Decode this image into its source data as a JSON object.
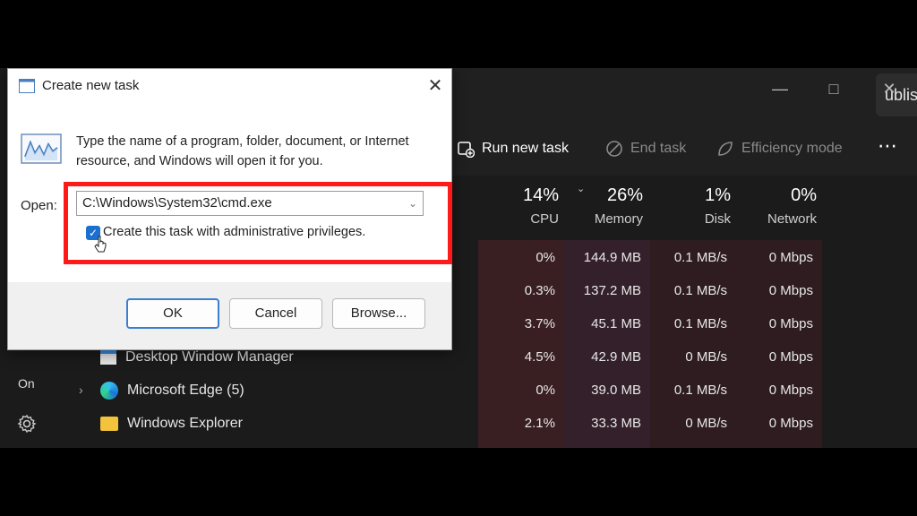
{
  "dialog": {
    "title": "Create new task",
    "description": "Type the name of a program, folder, document, or Internet resource, and Windows will open it for you.",
    "open_label": "Open:",
    "open_value": "C:\\Windows\\System32\\cmd.exe",
    "admin_checkbox_label": "Create this task with administrative privileges.",
    "admin_checked": true,
    "ok_label": "OK",
    "cancel_label": "Cancel",
    "browse_label": "Browse..."
  },
  "task_manager": {
    "search_text": "ublisher, or PID to se...",
    "toolbar": {
      "run_new_task": "Run new task",
      "end_task": "End task",
      "efficiency_mode": "Efficiency mode"
    },
    "columns": [
      {
        "pct": "14%",
        "label": "CPU"
      },
      {
        "pct": "26%",
        "label": "Memory"
      },
      {
        "pct": "1%",
        "label": "Disk"
      },
      {
        "pct": "0%",
        "label": "Network"
      }
    ],
    "rows": [
      {
        "name": "",
        "cpu": "0%",
        "memory": "144.9 MB",
        "disk": "0.1 MB/s",
        "network": "0 Mbps"
      },
      {
        "name": "",
        "cpu": "0.3%",
        "memory": "137.2 MB",
        "disk": "0.1 MB/s",
        "network": "0 Mbps"
      },
      {
        "name": "",
        "cpu": "3.7%",
        "memory": "45.1 MB",
        "disk": "0.1 MB/s",
        "network": "0 Mbps"
      },
      {
        "name": "Desktop Window Manager",
        "cpu": "4.5%",
        "memory": "42.9 MB",
        "disk": "0 MB/s",
        "network": "0 Mbps"
      },
      {
        "name": "Microsoft Edge (5)",
        "cpu": "0%",
        "memory": "39.0 MB",
        "disk": "0.1 MB/s",
        "network": "0 Mbps"
      },
      {
        "name": "Windows Explorer",
        "cpu": "2.1%",
        "memory": "33.3 MB",
        "disk": "0 MB/s",
        "network": "0 Mbps"
      }
    ],
    "sidebar_partial_text": "On"
  },
  "colors": {
    "highlight_box": "#ff1a1a",
    "checkbox_blue": "#1a6fcf",
    "heat_cell": "#3a1f22"
  }
}
